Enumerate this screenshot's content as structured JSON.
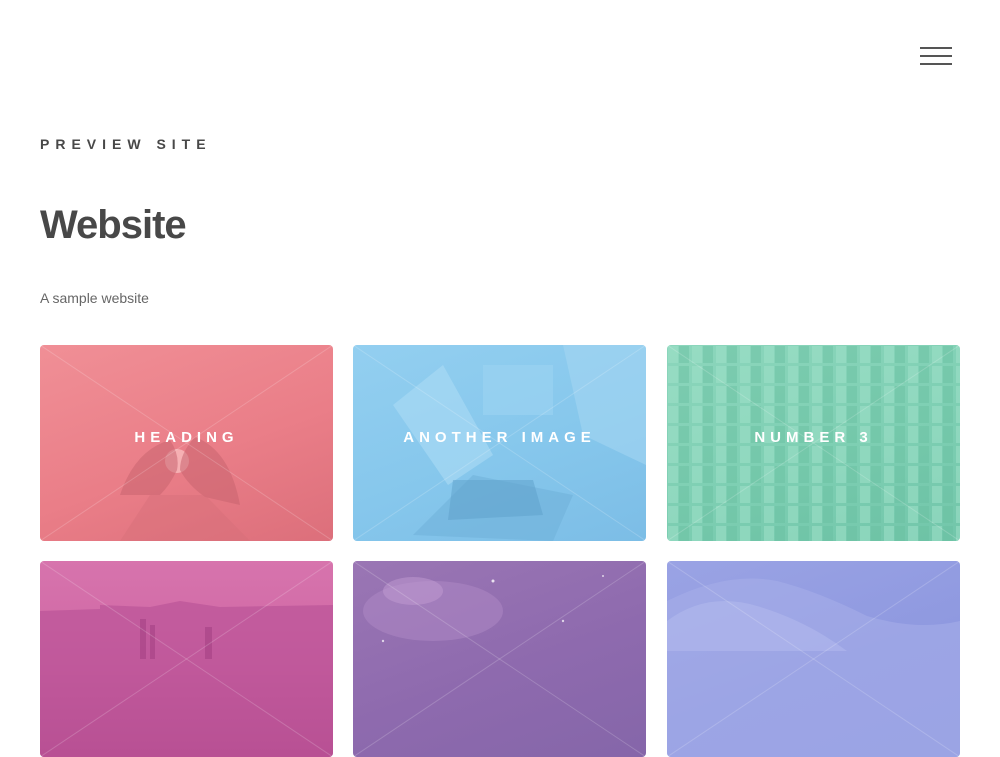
{
  "header": {
    "menu_icon": "hamburger-menu-icon"
  },
  "hero": {
    "eyebrow": "PREVIEW SITE",
    "title": "Website",
    "description": "A sample website"
  },
  "tiles": [
    {
      "caption": "HEADING",
      "color": "#ea7e88"
    },
    {
      "caption": "ANOTHER IMAGE",
      "color": "#86c7ec"
    },
    {
      "caption": "NUMBER 3",
      "color": "#7ecfb3"
    },
    {
      "caption": "",
      "color": "#cf67a4"
    },
    {
      "caption": "",
      "color": "#8e6aae"
    },
    {
      "caption": "",
      "color": "#8f99e0"
    }
  ]
}
